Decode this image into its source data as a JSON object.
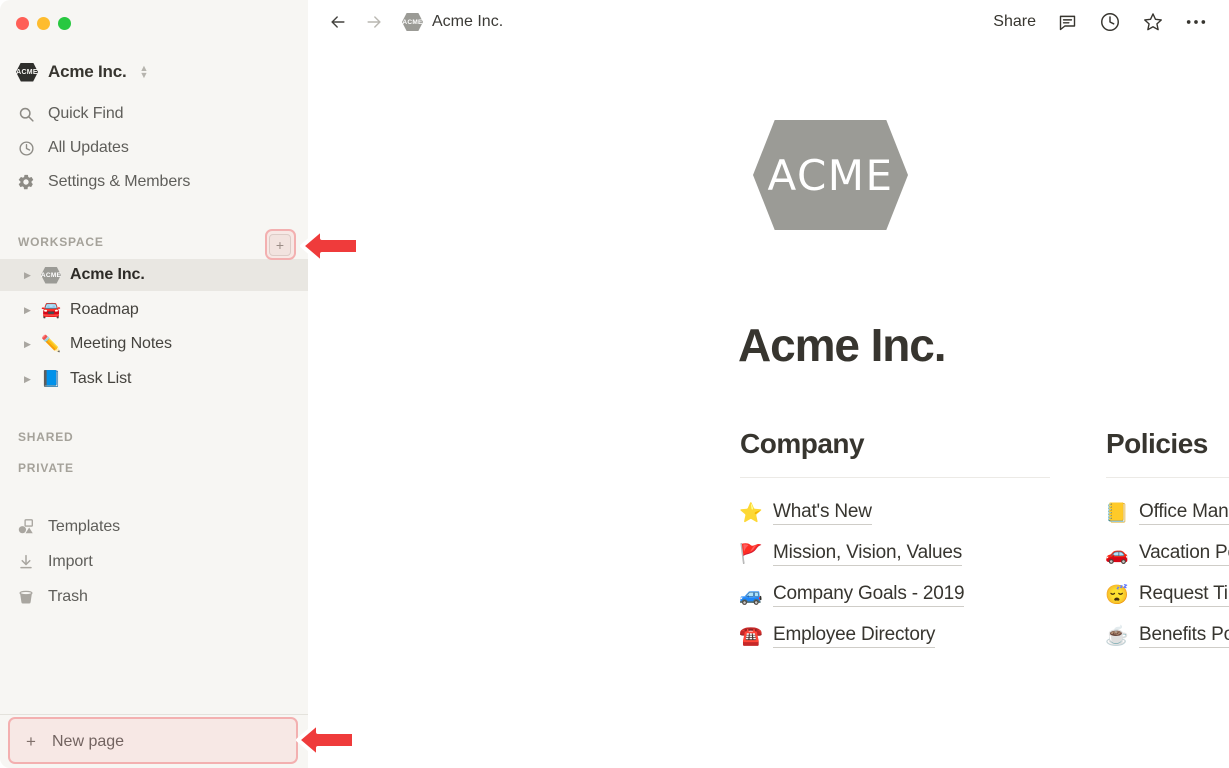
{
  "window": {
    "traffic_lights": [
      {
        "name": "close",
        "color": "#ff5f57"
      },
      {
        "name": "minimize",
        "color": "#febc2e"
      },
      {
        "name": "maximize",
        "color": "#28c840"
      }
    ]
  },
  "sidebar": {
    "workspace_switcher": {
      "label": "Acme Inc.",
      "icon": "ACME",
      "chevron": "updown-chevron-icon"
    },
    "nav": [
      {
        "label": "Quick Find",
        "icon": "search-icon"
      },
      {
        "label": "All Updates",
        "icon": "clock-icon"
      },
      {
        "label": "Settings & Members",
        "icon": "gear-icon"
      }
    ],
    "sections": {
      "workspace_heading": "WORKSPACE",
      "shared_heading": "SHARED",
      "private_heading": "PRIVATE"
    },
    "add_page_button": {
      "label": "+",
      "icon": "plus-icon"
    },
    "workspace_pages": [
      {
        "label": "Acme Inc.",
        "emoji": "ACME",
        "selected": true
      },
      {
        "label": "Roadmap",
        "emoji": "🚘",
        "selected": false
      },
      {
        "label": "Meeting Notes",
        "emoji": "✏️",
        "selected": false
      },
      {
        "label": "Task List",
        "emoji": "📘",
        "selected": false
      }
    ],
    "utility": [
      {
        "label": "Templates",
        "icon": "templates-icon"
      },
      {
        "label": "Import",
        "icon": "import-download-icon"
      },
      {
        "label": "Trash",
        "icon": "trash-icon"
      }
    ],
    "new_page": {
      "label": "New page",
      "icon": "plus-icon"
    }
  },
  "topbar": {
    "back": "back-arrow-icon",
    "forward": "forward-arrow-icon",
    "breadcrumb_title": "Acme Inc.",
    "breadcrumb_icon": "ACME",
    "share_label": "Share",
    "icons": [
      {
        "name": "comment-icon"
      },
      {
        "name": "history-clock-icon"
      },
      {
        "name": "favorite-star-icon"
      },
      {
        "name": "more-options-icon"
      }
    ]
  },
  "content": {
    "logo_text": "ACME",
    "page_title": "Acme Inc.",
    "columns": [
      {
        "heading": "Company",
        "links": [
          {
            "emoji": "⭐",
            "label": "What's New"
          },
          {
            "emoji": "🚩",
            "label": "Mission, Vision, Values"
          },
          {
            "emoji": "🚙",
            "label": "Company Goals - 2019"
          },
          {
            "emoji": "☎️",
            "label": "Employee Directory"
          }
        ]
      },
      {
        "heading": "Policies",
        "links": [
          {
            "emoji": "📒",
            "label": "Office Manual"
          },
          {
            "emoji": "🚗",
            "label": "Vacation Policy"
          },
          {
            "emoji": "😴",
            "label": "Request Time Off"
          },
          {
            "emoji": "☕",
            "label": "Benefits Policies"
          }
        ]
      }
    ]
  },
  "annotations": {
    "highlight_color": "#f3b0b0",
    "arrow_color": "#ef3b3b",
    "targets": [
      "add-page-button",
      "new-page-button"
    ]
  }
}
